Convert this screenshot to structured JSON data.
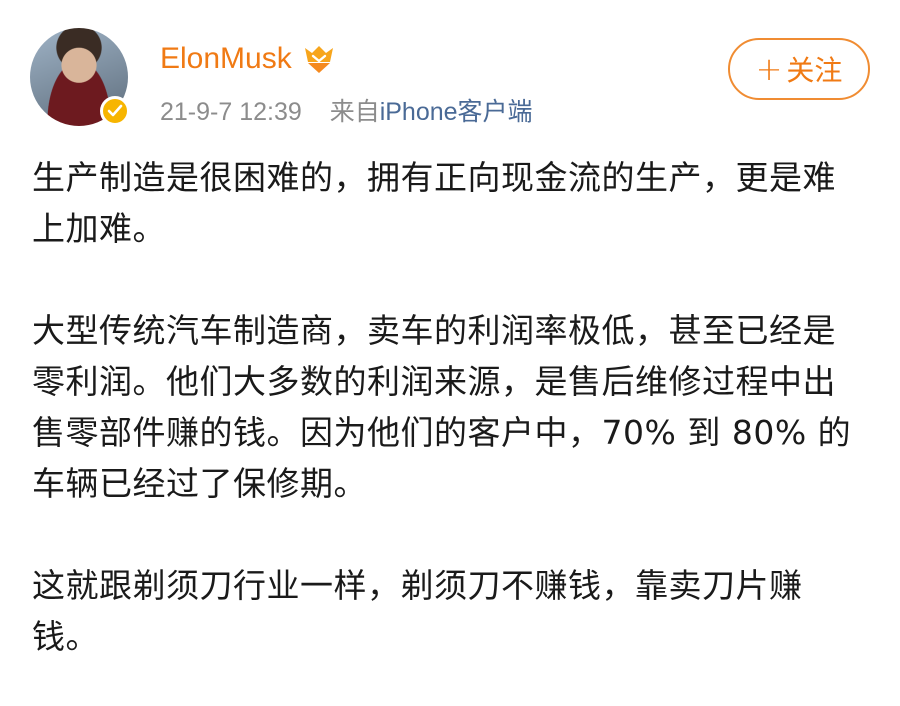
{
  "post": {
    "author": {
      "name": "ElonMusk",
      "avatar_icon": "profile-photo",
      "verified_icon": "verified-check-icon",
      "badge_icon": "vip-badge-icon"
    },
    "timestamp": "21-9-7 12:39",
    "source_prefix": "来自",
    "source": "iPhone客户端",
    "follow_label": "关注",
    "paragraphs": [
      "生产制造是很困难的，拥有正向现金流的生产，更是难上加难。",
      "大型传统汽车制造商，卖车的利润率极低，甚至已经是零利润。他们大多数的利润来源，是售后维修过程中出售零部件赚的钱。因为他们的客户中，70% 到 80% 的车辆已经过了保修期。",
      "这就跟剃须刀行业一样，剃须刀不赚钱，靠卖刀片赚钱。"
    ]
  },
  "colors": {
    "accent": "#f07a14",
    "meta": "#8c8c8c",
    "link": "#4a6a96",
    "verified": "#f7b500"
  }
}
